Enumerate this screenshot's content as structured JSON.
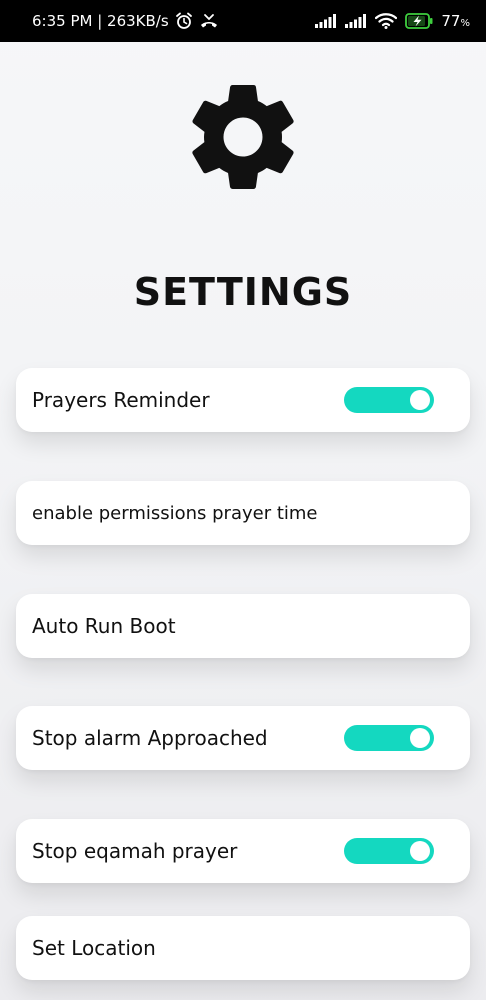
{
  "status_bar": {
    "time_speed": "6:35 PM | 263KB/s",
    "battery_level": "77",
    "battery_unit": "%",
    "icons": [
      "alarm-icon",
      "missed-call-icon",
      "signal-icon",
      "signal-icon",
      "wifi-icon",
      "battery-charging-icon"
    ]
  },
  "header": {
    "icon": "gear-icon",
    "title": "SETTINGS"
  },
  "settings": {
    "items": [
      {
        "label": "Prayers Reminder",
        "has_toggle": true,
        "toggle_on": true
      },
      {
        "label": "enable permissions prayer time",
        "has_toggle": false
      },
      {
        "label": "Auto Run Boot",
        "has_toggle": false
      },
      {
        "label": "Stop alarm Approached",
        "has_toggle": true,
        "toggle_on": true
      },
      {
        "label": "Stop eqamah prayer",
        "has_toggle": true,
        "toggle_on": true
      },
      {
        "label": "Set Location",
        "has_toggle": false
      }
    ]
  },
  "colors": {
    "accent": "#14d8c0",
    "status_bar_bg": "#000000",
    "battery_charging": "#3ecf3e"
  }
}
